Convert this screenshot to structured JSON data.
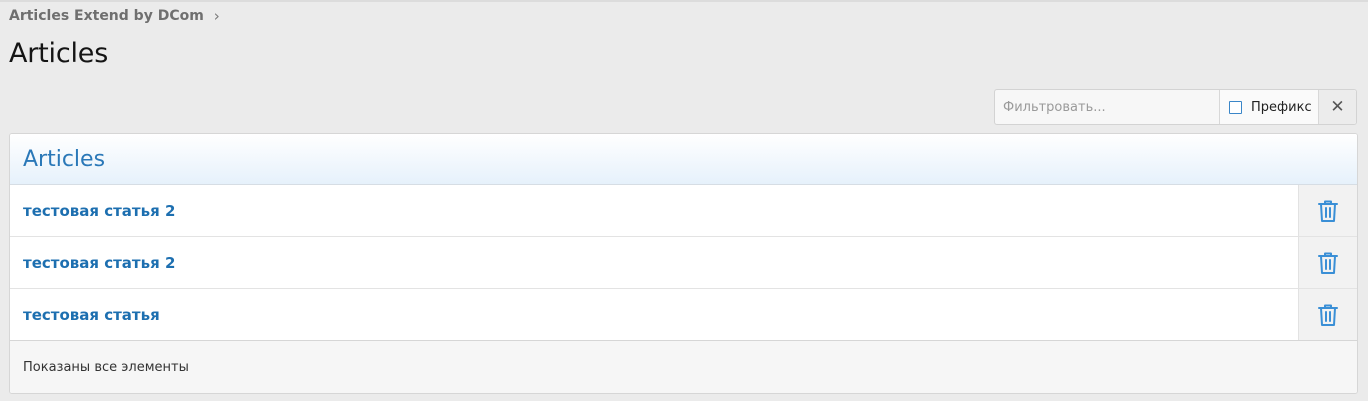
{
  "breadcrumb": {
    "label": "Articles Extend by DCom",
    "separator": "›"
  },
  "page": {
    "title": "Articles"
  },
  "filter": {
    "placeholder": "Фильтровать...",
    "value": "",
    "prefix_label": "Префикс",
    "prefix_checked": false,
    "clear_symbol": "✕"
  },
  "panel": {
    "title": "Articles",
    "rows": [
      {
        "title": "тестовая статья 2",
        "action_icon": "trash-icon"
      },
      {
        "title": "тестовая статья 2",
        "action_icon": "trash-icon"
      },
      {
        "title": "тестовая статья",
        "action_icon": "trash-icon"
      }
    ],
    "footer": "Показаны все элементы"
  },
  "colors": {
    "accent": "#2a78b8",
    "link": "#1d6fb0",
    "icon": "#3a8fd6",
    "background": "#ebebeb"
  }
}
